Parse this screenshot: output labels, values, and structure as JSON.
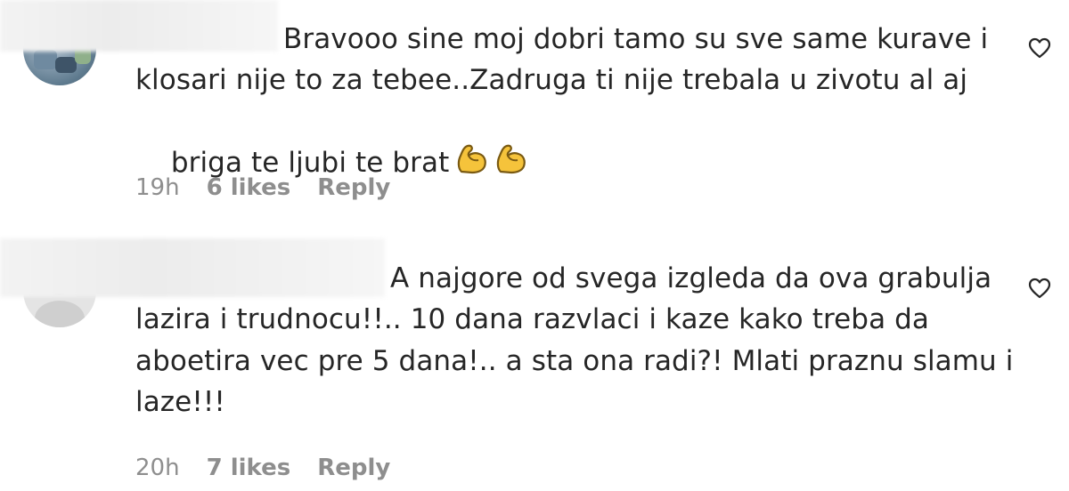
{
  "comments": [
    {
      "line1": "Bravooo sine moj dobri tamo su sve same kurave i",
      "line2": "klosari nije to za tebee..Zadruga ti nije trebala u zivotu al aj",
      "line3": "briga te ljubi te brat",
      "emojis": [
        "flexed-biceps",
        "flexed-biceps"
      ],
      "time": "19h",
      "likes": "6 likes",
      "reply": "Reply",
      "like_icon": "heart-outline-icon"
    },
    {
      "line1": "A najgore od svega izgleda da ova grabulja",
      "line2": "lazira i trudnocu!!.. 10 dana razvlaci i kaze kako treba da",
      "line3": "aboetira vec pre 5 dana!.. a sta ona radi?! Mlati praznu slamu i",
      "line4": "laze!!!",
      "time": "20h",
      "likes": "7 likes",
      "reply": "Reply",
      "like_icon": "heart-outline-icon"
    }
  ],
  "colors": {
    "text": "#262626",
    "meta": "#8e8e8e",
    "emoji": "#f5c33b"
  }
}
